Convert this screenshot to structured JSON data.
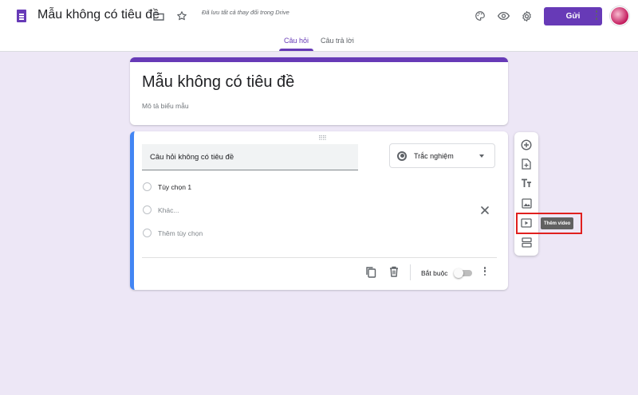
{
  "header": {
    "doc_title": "Mẫu không có tiêu đề",
    "save_status": "Đã lưu tất cả thay đổi trong Drive",
    "send_label": "Gửi",
    "icons": [
      "folder-icon",
      "star-icon",
      "palette-icon",
      "eye-icon",
      "gear-icon",
      "more-vert-icon"
    ]
  },
  "tabs": [
    {
      "label": "Câu hỏi",
      "active": true
    },
    {
      "label": "Câu trả lời",
      "active": false
    }
  ],
  "form": {
    "title": "Mẫu không có tiêu đề",
    "description_placeholder": "Mô tả biểu mẫu"
  },
  "question": {
    "title": "Câu hỏi không có tiêu đề",
    "type_label": "Trắc nghiệm",
    "options": [
      {
        "label": "Tùy chọn 1"
      },
      {
        "label": "Khác..."
      },
      {
        "label": "Thêm tùy chọn"
      }
    ],
    "required_label": "Bắt buộc",
    "required": false
  },
  "side_toolbar": {
    "buttons": [
      "add-question-icon",
      "import-questions-icon",
      "add-title-icon",
      "add-image-icon",
      "add-video-icon",
      "add-section-icon"
    ],
    "tooltip": "Thêm video"
  },
  "colors": {
    "accent": "#673ab7",
    "background": "#ede7f6",
    "active_card_border": "#4285f4",
    "highlight": "#e0201f"
  }
}
